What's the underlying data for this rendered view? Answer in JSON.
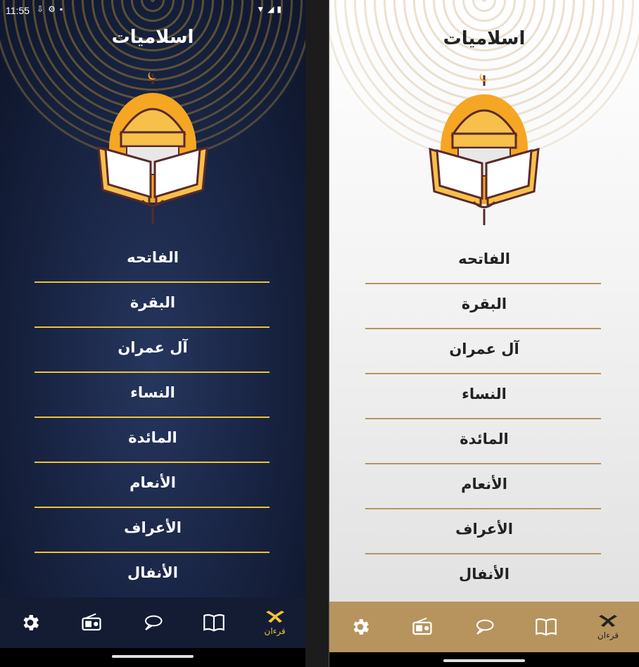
{
  "status_bar": {
    "time": "11:55",
    "left_icons": [
      "download-icon",
      "settings-status-icon",
      "sd-card-icon"
    ],
    "right_icons": [
      "wifi-icon",
      "signal-icon",
      "battery-icon"
    ]
  },
  "app": {
    "title": "اسلاميات"
  },
  "suras": [
    "الفاتحه",
    "البقرة",
    "آل عمران",
    "النساء",
    "المائدة",
    "الأنعام",
    "الأعراف",
    "الأنفال"
  ],
  "bottom_nav": {
    "items": [
      {
        "icon": "gear-icon",
        "label": ""
      },
      {
        "icon": "radio-icon",
        "label": ""
      },
      {
        "icon": "chat-icon",
        "label": ""
      },
      {
        "icon": "book-icon",
        "label": ""
      },
      {
        "icon": "quran-icon",
        "label": "قرءان"
      }
    ]
  },
  "themes": {
    "dark": {
      "accent": "#f2c233",
      "background": "#1a2646",
      "nav_background": "#131c33"
    },
    "light": {
      "accent": "#b7945e",
      "background": "#f4f4f4",
      "nav_background": "#b7945e"
    }
  }
}
